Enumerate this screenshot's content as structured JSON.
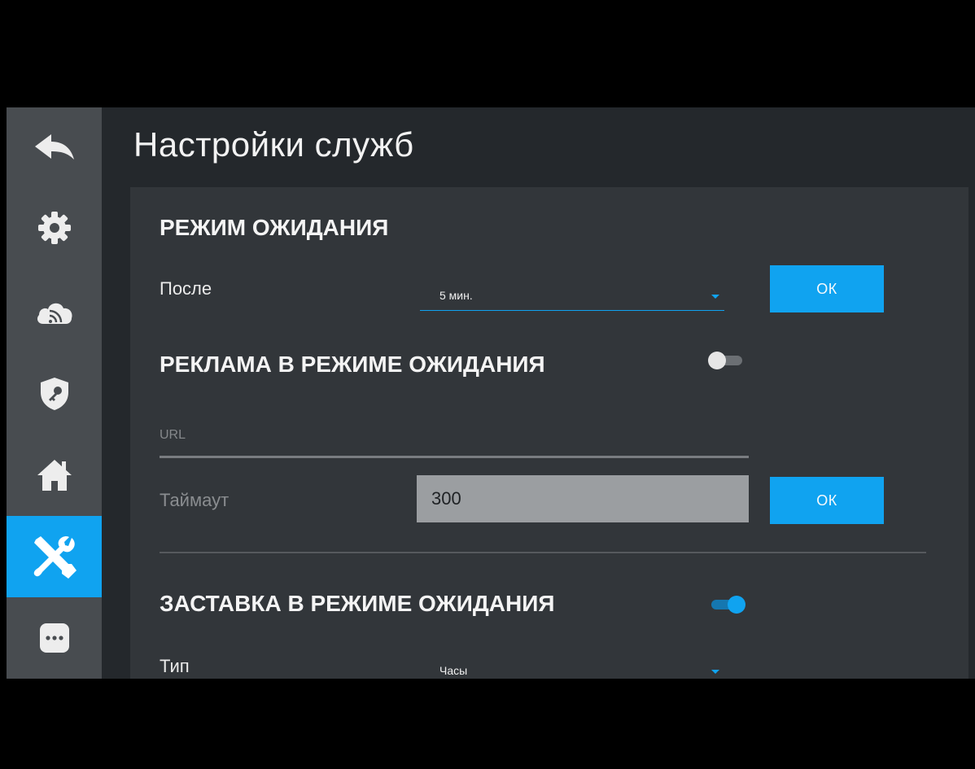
{
  "page": {
    "title": "Настройки служб"
  },
  "sidebar": {
    "items": [
      {
        "icon": "back-arrow-icon",
        "active": false
      },
      {
        "icon": "gear-icon",
        "active": false
      },
      {
        "icon": "cloud-signal-icon",
        "active": false
      },
      {
        "icon": "shield-key-icon",
        "active": false
      },
      {
        "icon": "home-icon",
        "active": false
      },
      {
        "icon": "tools-icon",
        "active": true
      },
      {
        "icon": "more-icon",
        "active": false
      }
    ]
  },
  "standby": {
    "heading": "РЕЖИМ ОЖИДАНИЯ",
    "after_label": "После",
    "after_value": "5 мин.",
    "ok_label": "ОК"
  },
  "ads": {
    "heading": "РЕКЛАМА В РЕЖИМЕ ОЖИДАНИЯ",
    "enabled": false,
    "url_placeholder": "URL",
    "url_value": "",
    "timeout_label": "Таймаут",
    "timeout_value": "300",
    "ok_label": "ОК"
  },
  "screensaver": {
    "heading": "ЗАСТАВКА В РЕЖИМЕ ОЖИДАНИЯ",
    "enabled": true,
    "type_label": "Тип",
    "type_value": "Часы"
  },
  "colors": {
    "accent": "#10a3f0",
    "sidebar": "#484c50",
    "background": "#24282c",
    "panel": "#32363a"
  }
}
